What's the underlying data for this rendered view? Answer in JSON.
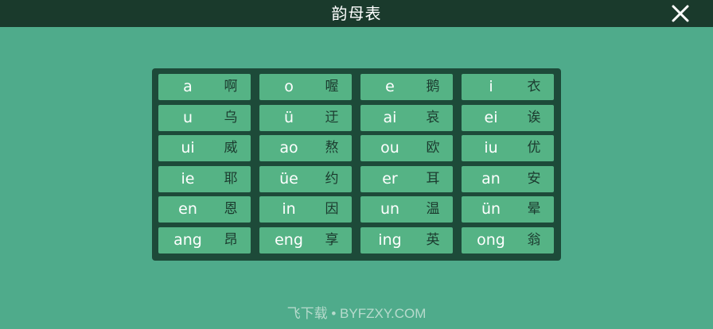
{
  "header": {
    "title": "韵母表",
    "close_icon": "close-icon"
  },
  "finals": [
    {
      "pinyin": "a",
      "hanzi": "啊"
    },
    {
      "pinyin": "o",
      "hanzi": "喔"
    },
    {
      "pinyin": "e",
      "hanzi": "鹅"
    },
    {
      "pinyin": "i",
      "hanzi": "衣"
    },
    {
      "pinyin": "u",
      "hanzi": "乌"
    },
    {
      "pinyin": "ü",
      "hanzi": "迂"
    },
    {
      "pinyin": "ai",
      "hanzi": "哀"
    },
    {
      "pinyin": "ei",
      "hanzi": "诶"
    },
    {
      "pinyin": "ui",
      "hanzi": "威"
    },
    {
      "pinyin": "ao",
      "hanzi": "熬"
    },
    {
      "pinyin": "ou",
      "hanzi": "欧"
    },
    {
      "pinyin": "iu",
      "hanzi": "优"
    },
    {
      "pinyin": "ie",
      "hanzi": "耶"
    },
    {
      "pinyin": "üe",
      "hanzi": "约"
    },
    {
      "pinyin": "er",
      "hanzi": "耳"
    },
    {
      "pinyin": "an",
      "hanzi": "安"
    },
    {
      "pinyin": "en",
      "hanzi": "恩"
    },
    {
      "pinyin": "in",
      "hanzi": "因"
    },
    {
      "pinyin": "un",
      "hanzi": "温"
    },
    {
      "pinyin": "ün",
      "hanzi": "晕"
    },
    {
      "pinyin": "ang",
      "hanzi": "昂"
    },
    {
      "pinyin": "eng",
      "hanzi": "享"
    },
    {
      "pinyin": "ing",
      "hanzi": "英"
    },
    {
      "pinyin": "ong",
      "hanzi": "翁"
    }
  ],
  "watermark": "飞下载 • BYFZXY.COM",
  "colors": {
    "background": "#4fab8b",
    "header": "#1a3a2c",
    "board": "#1d4a39",
    "cell": "#55b385",
    "hanzi": "#1b3a2e"
  }
}
